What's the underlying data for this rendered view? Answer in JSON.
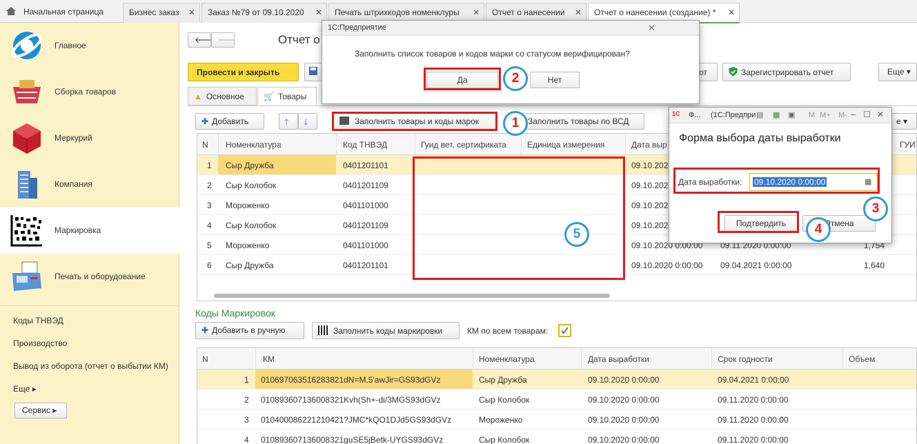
{
  "tabs": [
    {
      "label": "Начальная страница"
    },
    {
      "label": "Бизнес заказ"
    },
    {
      "label": "Заказ №79 от 09.10.2020"
    },
    {
      "label": "Печать штрихкодов номенклуры"
    },
    {
      "label": "Отчет о нанесении"
    },
    {
      "label": "Отчет о нанесении (создание) *"
    }
  ],
  "sidebar": {
    "items": [
      {
        "label": "Главное"
      },
      {
        "label": "Сборка товаров"
      },
      {
        "label": "Меркурий"
      },
      {
        "label": "Компания"
      },
      {
        "label": "Маркировка"
      },
      {
        "label": "Печать и оборудование"
      }
    ],
    "links": [
      "Коды ТНВЭД",
      "Производство",
      "Вывод из оборота (отчет о выбытии КМ)",
      "Еще ▸"
    ],
    "service": "Сервис ▸"
  },
  "doc": {
    "title": "Отчет о",
    "post_close": "Провести и закрыть",
    "register": "Зарегистрировать отчет",
    "report_frag": "от",
    "more": "Еще",
    "tab_main": "Основное",
    "tab_goods": "Товары",
    "add": "Добавить",
    "fill_goods": "Заполнить товары и коды марок",
    "fill_vsd": "Заполнить товары по ВСД",
    "more_frag": "е"
  },
  "goods": {
    "headers": [
      "N",
      "Номенклатура",
      "Код ТНВЭД",
      "Гуид вет. сертификата",
      "Единица измерения",
      "Дата выр",
      "ГУИ"
    ],
    "rows": [
      {
        "n": "1",
        "name": "Сыр Дружба",
        "code": "0401201101",
        "date": "09.10.2020",
        "d2": "",
        "v": ""
      },
      {
        "n": "2",
        "name": "Сыр Колобок",
        "code": "0401201109",
        "date": "09.10.2020",
        "d2": "",
        "v": ""
      },
      {
        "n": "3",
        "name": "Мороженко",
        "code": "0401101000",
        "date": "09.10.2020",
        "d2": "",
        "v": ""
      },
      {
        "n": "4",
        "name": "Сыр Колобок",
        "code": "0401201109",
        "date": "09.10.2020",
        "d2": "",
        "v": ""
      },
      {
        "n": "5",
        "name": "Мороженко",
        "code": "0401101000",
        "date": "09.10.2020 0:00:00",
        "d2": "09.11.2020 0:00:00",
        "v": "1,754"
      },
      {
        "n": "6",
        "name": "Сыр Дружба",
        "code": "0401201101",
        "date": "09.10.2020 0:00:00",
        "d2": "09.04.2021 0:00:00",
        "v": "1,640"
      }
    ]
  },
  "codes": {
    "title": "Коды Маркировок",
    "add_manual": "Добавить в ручную",
    "fill_codes": "Заполнить коды маркировки",
    "km_all": "КМ по всем товарам:",
    "headers": [
      "N",
      "КМ",
      "Номенклатура",
      "Дата выработки",
      "Срок годности",
      "Объем"
    ],
    "rows": [
      {
        "n": "1",
        "km": "010697063516283821dN=M.5'awJir=GS93dGVz",
        "name": "Сыр Дружба",
        "date": "09.10.2020 0:00:00",
        "exp": "09.04.2021 0:00:00"
      },
      {
        "n": "2",
        "km": "010893607136008321Kvh(Sh+-di/3MGS93dGVz",
        "name": "Сыр Колобок",
        "date": "09.10.2020 0:00:00",
        "exp": "09.11.2020 0:00:00"
      },
      {
        "n": "3",
        "km": "010400086221210421?JMC*kQO1DJd5GS93dGVz",
        "name": "Мороженко",
        "date": "09.10.2020 0:00:00",
        "exp": "09.11.2020 0:00:00"
      },
      {
        "n": "4",
        "km": "010893607136008321guSE5jBetk-UYGS93dGVz",
        "name": "Сыр Колобок",
        "date": "09.10.2020 0:00:00",
        "exp": "09.11.2020 0:00:00"
      }
    ]
  },
  "dialog1": {
    "title": "1С:Предприятие",
    "question": "Заполнить список товаров и кодов марки со статусом верифицирован?",
    "yes": "Да",
    "no": "Нет"
  },
  "dialog2": {
    "title_frag": "Ф...",
    "app": "(1С:Предпри",
    "heading": "Форма выбора даты выработки",
    "date_label": "Дата выработки:",
    "date_value": "09.10.2020  0:00:00",
    "confirm": "Подтвердить",
    "cancel": "Отмена",
    "tb": [
      "M",
      "M+",
      "M-"
    ]
  },
  "markers": [
    "1",
    "2",
    "3",
    "4",
    "5"
  ],
  "colors": {
    "accent_red": "#e21b1b",
    "circle_blue": "#2e9bd6",
    "sidebar_bg": "#fbf3c8",
    "yellow_btn": "#f7dc3a",
    "row_highlight": "#fdf1c3",
    "link_green": "#2f8a3a"
  }
}
